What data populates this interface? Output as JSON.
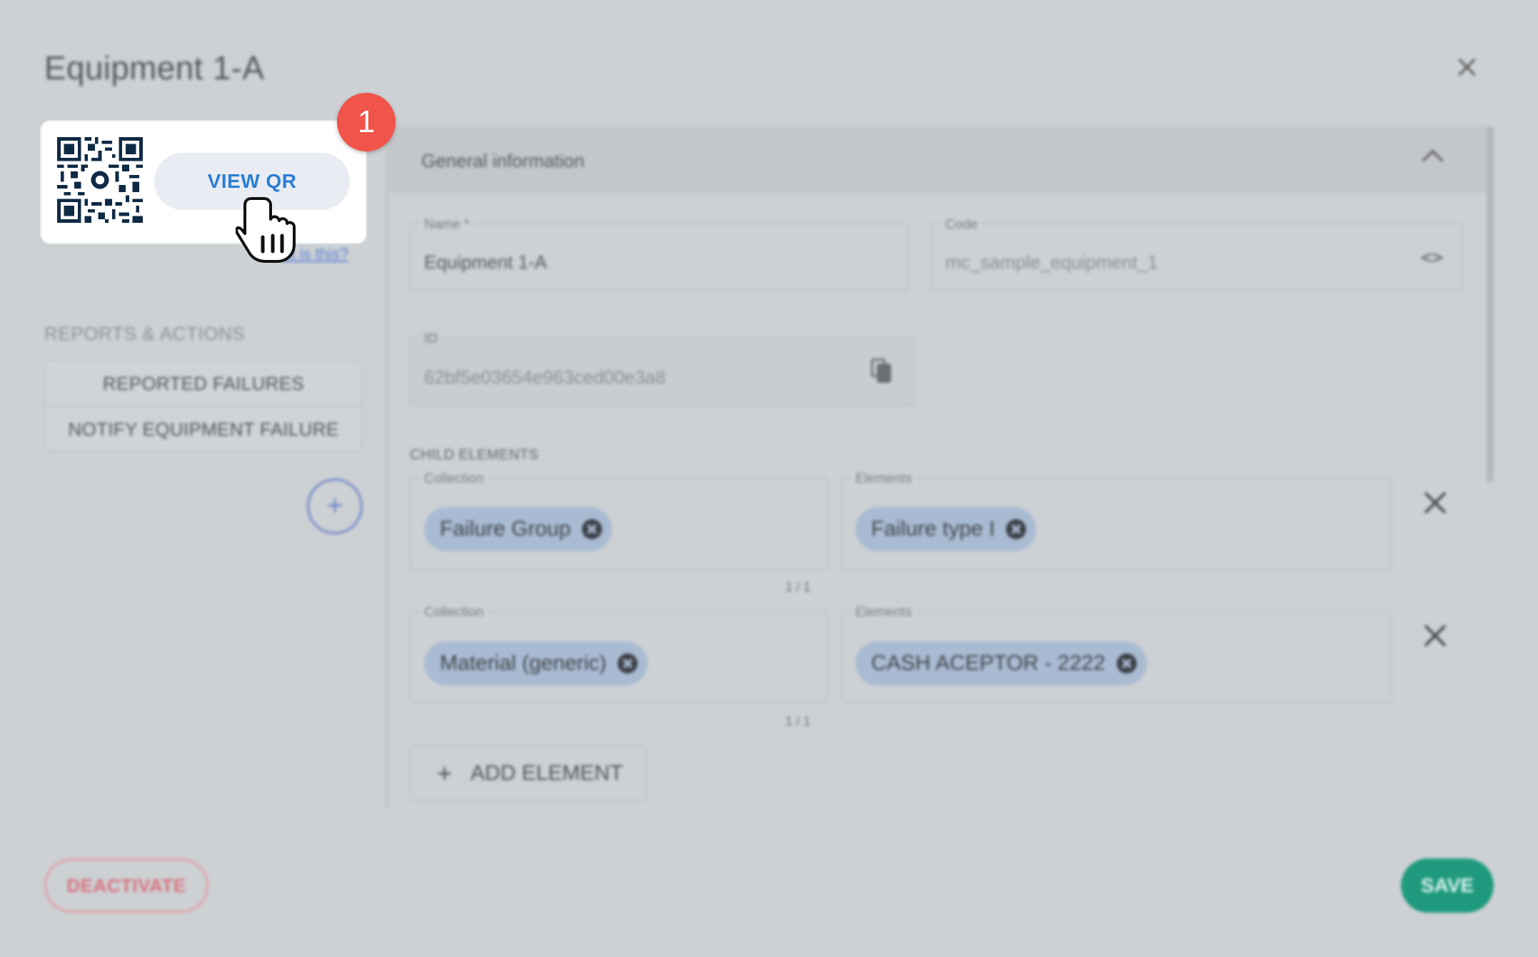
{
  "dialog": {
    "title": "Equipment 1-A",
    "close_icon": "close-icon"
  },
  "qr_card": {
    "view_button": "VIEW QR",
    "help_link": "at is this?",
    "step_number": "1"
  },
  "sidebar": {
    "section_title": "REPORTS & ACTIONS",
    "actions": [
      "REPORTED FAILURES",
      "NOTIFY EQUIPMENT FAILURE"
    ],
    "add_icon": "plus-icon"
  },
  "general": {
    "title": "General information",
    "name_label": "Name *",
    "name_value": "Equipment 1-A",
    "code_label": "Code",
    "code_value": "mc_sample_equipment_1",
    "id_label": "ID",
    "id_value": "62bf5e03654e963ced00e3a8"
  },
  "child_elements": {
    "title": "CHILD ELEMENTS",
    "collection_label": "Collection",
    "elements_label": "Elements",
    "rows": [
      {
        "collection": "Failure Group",
        "element": "Failure type I",
        "counter": "1 / 1"
      },
      {
        "collection": "Material (generic)",
        "element": "CASH ACEPTOR - 2222",
        "counter": "1 / 1"
      }
    ],
    "add_button": "ADD ELEMENT"
  },
  "footer": {
    "deactivate": "DEACTIVATE",
    "save": "SAVE"
  },
  "colors": {
    "accent": "#2a7fd4",
    "badge": "#f0544a",
    "save": "#1f9a7e",
    "danger": "#d9707c"
  }
}
